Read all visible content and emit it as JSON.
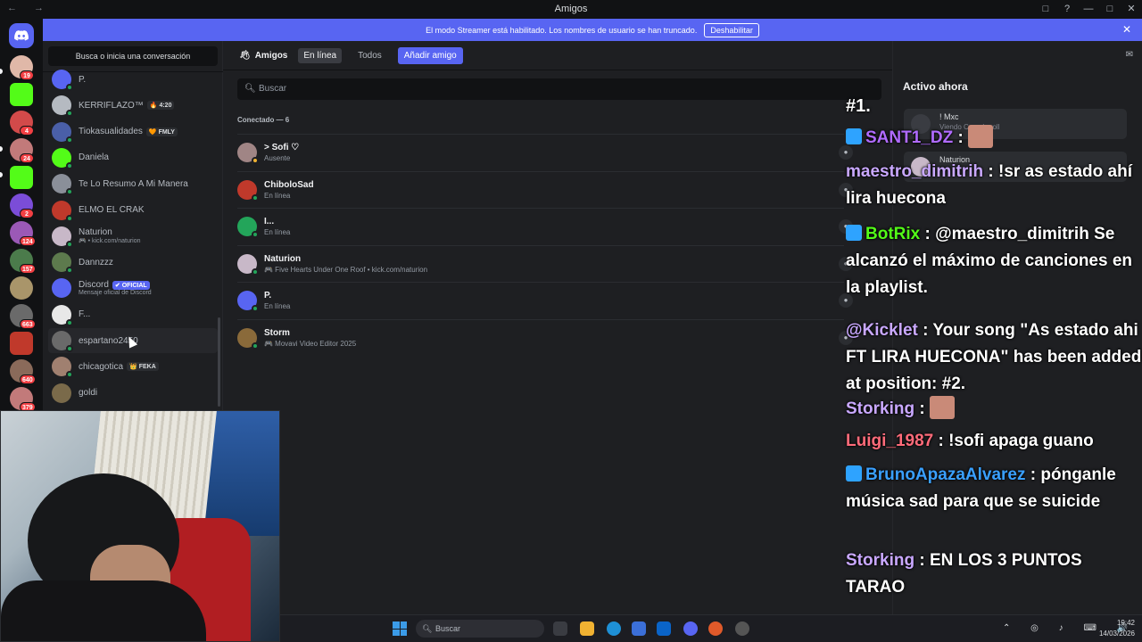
{
  "window": {
    "title": "Amigos",
    "nav_icons": "← →",
    "controls": [
      "□",
      "?",
      "—",
      "□",
      "✕"
    ]
  },
  "banner": {
    "message": "El modo Streamer está habilitado. Los nombres de usuario se han truncado.",
    "button": "Deshabilitar",
    "close": "✕"
  },
  "guilds": {
    "badges": [
      "19",
      "4",
      "24",
      "2",
      "124",
      "157",
      "663",
      "640",
      "379"
    ],
    "colors": [
      "#5865f2",
      "#e0b8a8",
      "#53fc18",
      "#d24a4a",
      "#7b4dd8",
      "#9b59b6",
      "#4b7b4b",
      "#a9956a",
      "#c0392b",
      "#8a6a5a",
      "#c27a7a",
      "#6a6a6a"
    ]
  },
  "dm_panel": {
    "search": "Busca o inicia una conversación",
    "items": [
      {
        "name": "P.",
        "sub": "",
        "tag": "",
        "color": "#5865f2",
        "status": "#23a55a"
      },
      {
        "name": "KERRIFLAZO™",
        "sub": "",
        "tag": "🔥 4:20",
        "color": "#b5bac1",
        "status": "#23a55a"
      },
      {
        "name": "Tiokasualidades",
        "sub": "",
        "tag": "🧡 FMLY",
        "color": "#4a5fa8",
        "status": "#23a55a"
      },
      {
        "name": "Daniela",
        "sub": "",
        "tag": "",
        "color": "#53fc18",
        "status": "#23a55a"
      },
      {
        "name": "Te Lo Resumo A Mi Manera",
        "sub": "",
        "tag": "",
        "color": "#8a8f99",
        "status": "#23a55a"
      },
      {
        "name": "ELMO EL CRAK",
        "sub": "",
        "tag": "",
        "color": "#c0392b",
        "status": "#23a55a"
      },
      {
        "name": "Naturion",
        "sub": "🎮 • kick.com/naturion",
        "tag": "",
        "color": "#c8b8c8",
        "status": "#23a55a"
      },
      {
        "name": "Dannzzz",
        "sub": "",
        "tag": "",
        "color": "#5d7a4d",
        "status": "#23a55a"
      },
      {
        "name": "Discord",
        "sub": "Mensaje oficial de Discord",
        "tag": "✔ OFICIAL",
        "color": "#5865f2",
        "status": ""
      },
      {
        "name": "F...",
        "sub": "",
        "tag": "",
        "color": "#e8e8e8",
        "status": "#23a55a"
      },
      {
        "name": "espartano2450",
        "sub": "",
        "tag": "",
        "color": "#6a6a6a",
        "status": "#23a55a"
      },
      {
        "name": "chicagotica",
        "sub": "",
        "tag": "👑 FEKA",
        "color": "#a08070",
        "status": "#23a55a"
      },
      {
        "name": "goldi",
        "sub": "",
        "tag": "",
        "color": "#7a6a4a",
        "status": ""
      }
    ]
  },
  "friends": {
    "title": "Amigos",
    "tabs": [
      "En línea",
      "Todos"
    ],
    "add_button": "Añadir amigo",
    "search_placeholder": "Buscar",
    "header": "Conectado — 6",
    "rows": [
      {
        "name": "> Sofi ♡",
        "sub": "Ausente",
        "color": "#a08585",
        "status": "#f0b232"
      },
      {
        "name": "ChiboloSad",
        "sub": "En línea",
        "color": "#c0392b",
        "status": "#23a55a"
      },
      {
        "name": "I...",
        "sub": "En línea",
        "color": "#23a55a",
        "status": "#23a55a"
      },
      {
        "name": "Naturion",
        "sub": "🎮 Five Hearts Under One Roof • kick.com/naturion",
        "color": "#c8b8c8",
        "status": "#23a55a"
      },
      {
        "name": "P.",
        "sub": "En línea",
        "color": "#5865f2",
        "status": "#23a55a"
      },
      {
        "name": "Storm",
        "sub": "🎮 Movavi Video Editor 2025",
        "color": "#8a6a3a",
        "status": "#23a55a"
      }
    ]
  },
  "active_now": {
    "title": "Activo ahora",
    "cards": [
      {
        "name": "! Mxc",
        "sub": "Viendo Crunchyroll"
      },
      {
        "name": "Naturion",
        "sub": ""
      }
    ]
  },
  "chat": {
    "rank": "#1.",
    "lines": [
      {
        "user": "SANT1_DZ",
        "color": "#b06bff",
        "text": "",
        "badge": "#2ea3ff",
        "emote": true
      },
      {
        "user": "maestro_dimitrih",
        "color": "#c9a8ff",
        "text": ": !sr as estado ahí lira huecona",
        "badge": "",
        "emote": false
      },
      {
        "user": "BotRix",
        "color": "#53fc18",
        "text": ": @maestro_dimitrih Se alcanzó el máximo de canciones en la playlist.",
        "badge": "#2ea3ff",
        "emote": false
      },
      {
        "user": "@Kicklet",
        "color": "#c9a8ff",
        "text": ": Your song \"As estado ahi FT LIRA HUECONA\" has been added at position: #2.",
        "badge": "",
        "emote": false
      },
      {
        "user": "Storking",
        "color": "#c9a8ff",
        "text": "",
        "badge": "",
        "emote": true
      },
      {
        "user": "Luigi_1987",
        "color": "#ff6b7a",
        "text": ": !sofi apaga guano",
        "badge": "",
        "emote": false
      },
      {
        "user": "BrunoApazaAlvarez",
        "color": "#3aa0ff",
        "text": ": pónganle música sad para que se suicide",
        "badge": "#2ea3ff",
        "emote": false
      },
      {
        "user": "Storking",
        "color": "#c9a8ff",
        "text": ": EN LOS 3 PUNTOS TARAO",
        "badge": "",
        "emote": false
      }
    ]
  },
  "taskbar": {
    "search": "Buscar",
    "tray": "⌃ ◎ ♪ ⌨ 🔊",
    "time": "19:42",
    "date": "14/03/2026"
  }
}
